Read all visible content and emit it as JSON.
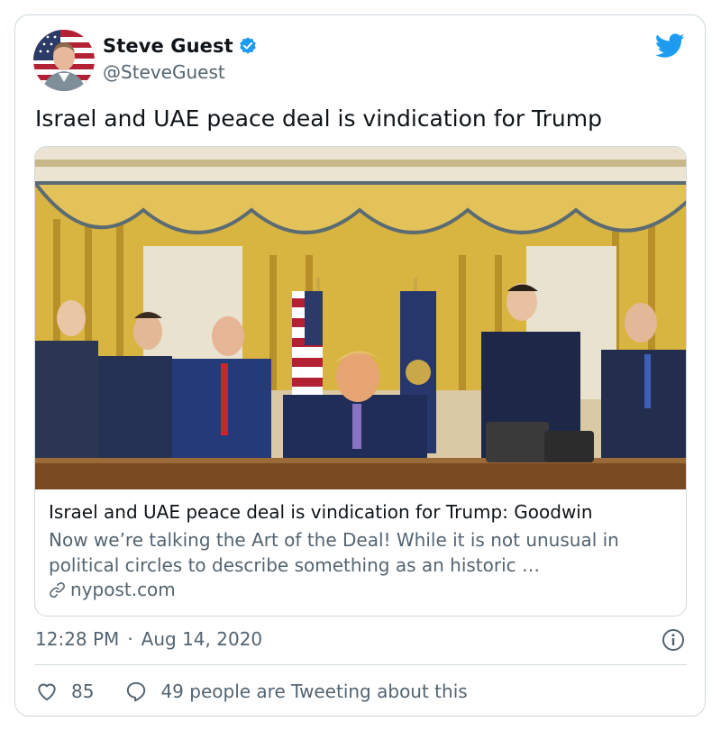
{
  "author": {
    "display_name": "Steve Guest",
    "handle": "@SteveGuest",
    "verified": true,
    "avatar_icon": "avatar-photo"
  },
  "tweet": {
    "text": "Israel and UAE peace deal is vindication for Trump",
    "time": "12:28 PM",
    "separator": "·",
    "date": "Aug 14, 2020"
  },
  "link_card": {
    "title": "Israel and UAE peace deal is vindication for Trump: Goodwin",
    "description": "Now we’re talking the Art of the Deal! While it is not unusual in political circles to describe something as an historic …",
    "domain": "nypost.com",
    "image_icon": "oval-office-photo"
  },
  "actions": {
    "like_count": "85",
    "conversation_text": "49 people are Tweeting about this"
  },
  "colors": {
    "twitter_blue": "#1d9bf0",
    "secondary_text": "#536471",
    "border": "#cfd9de"
  }
}
